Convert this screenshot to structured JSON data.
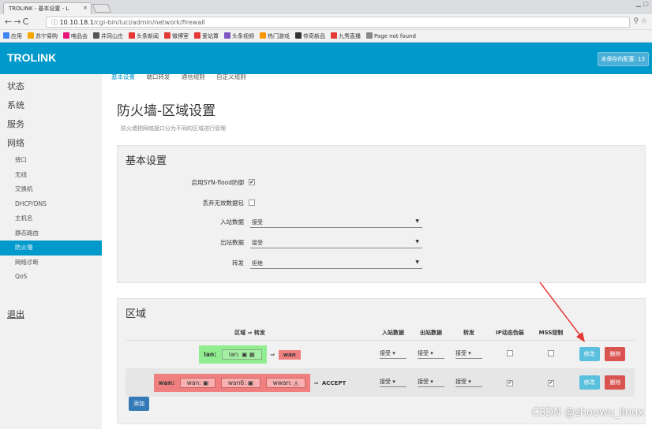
{
  "browser": {
    "tab_title": "TROLINK - 基本设置 - L",
    "tab_close": "×",
    "url_host": "10.10.18.1",
    "url_path": "/cgi-bin/luci/admin/network/firewall",
    "bookmarks": [
      {
        "label": "应用",
        "color": "#4285f4"
      },
      {
        "label": "苏宁易购",
        "color": "#f7a600"
      },
      {
        "label": "唯品会",
        "color": "#e7147a"
      },
      {
        "label": "井冈山庄",
        "color": "#555555"
      },
      {
        "label": "头条新闻",
        "color": "#e53935"
      },
      {
        "label": "微博室",
        "color": "#e53935"
      },
      {
        "label": "爱站算",
        "color": "#e53935"
      },
      {
        "label": "头条视频",
        "color": "#7e57c2"
      },
      {
        "label": "热门游戏",
        "color": "#ff9800"
      },
      {
        "label": "传奇新品",
        "color": "#333333"
      },
      {
        "label": "九秀直播",
        "color": "#e53935"
      },
      {
        "label": "Page not found",
        "color": "#888888"
      }
    ]
  },
  "header": {
    "brand": "TROLINK",
    "unsaved": "未保存的配置: 13"
  },
  "sidebar": {
    "top": [
      "状态",
      "系统",
      "服务",
      "网络"
    ],
    "network_items": [
      "接口",
      "无线",
      "交换机",
      "DHCP/DNS",
      "主机名",
      "静态路由",
      "防火墙",
      "网络诊断",
      "QoS"
    ],
    "active": "防火墙",
    "logout": "退出"
  },
  "main": {
    "tabs": [
      "基本设置",
      "端口转发",
      "通信规则",
      "自定义规则"
    ],
    "title": "防火墙-区域设置",
    "description": "防火墙把网络接口分为不同的区域进行管理",
    "basic": {
      "heading": "基本设置",
      "syn_label": "启用SYN-flood防御",
      "syn_checked": "✔",
      "drop_label": "丢弃无效数据包",
      "drop_checked": "",
      "input_label": "入站数据",
      "input_value": "接受",
      "output_label": "出站数据",
      "output_value": "接受",
      "forward_label": "转发",
      "forward_value": "拒绝"
    },
    "zones": {
      "heading": "区域",
      "headers": [
        "区域 ⇒ 转发",
        "入站数据",
        "出站数据",
        "转发",
        "IP动态伪装",
        "MSS钳制"
      ],
      "rows": [
        {
          "name": "lan:",
          "nets": [
            "lan:"
          ],
          "arrow": "⇒",
          "target": "wan",
          "input": "接受",
          "output": "接受",
          "forward": "接受",
          "masq": "",
          "mss": "",
          "edit": "修改",
          "delete": "删除"
        },
        {
          "name": "wan:",
          "nets": [
            "wan:",
            "wan6:",
            "wwan:"
          ],
          "arrow": "⇒",
          "target": "ACCEPT",
          "input": "接受",
          "output": "接受",
          "forward": "接受",
          "masq": "✔",
          "mss": "✔",
          "edit": "修改",
          "delete": "删除"
        }
      ],
      "add": "添加"
    }
  },
  "watermark": "CSDN @zhouwu_linux",
  "colors": {
    "accent": "#0099cc",
    "annotation": "#e53935"
  }
}
